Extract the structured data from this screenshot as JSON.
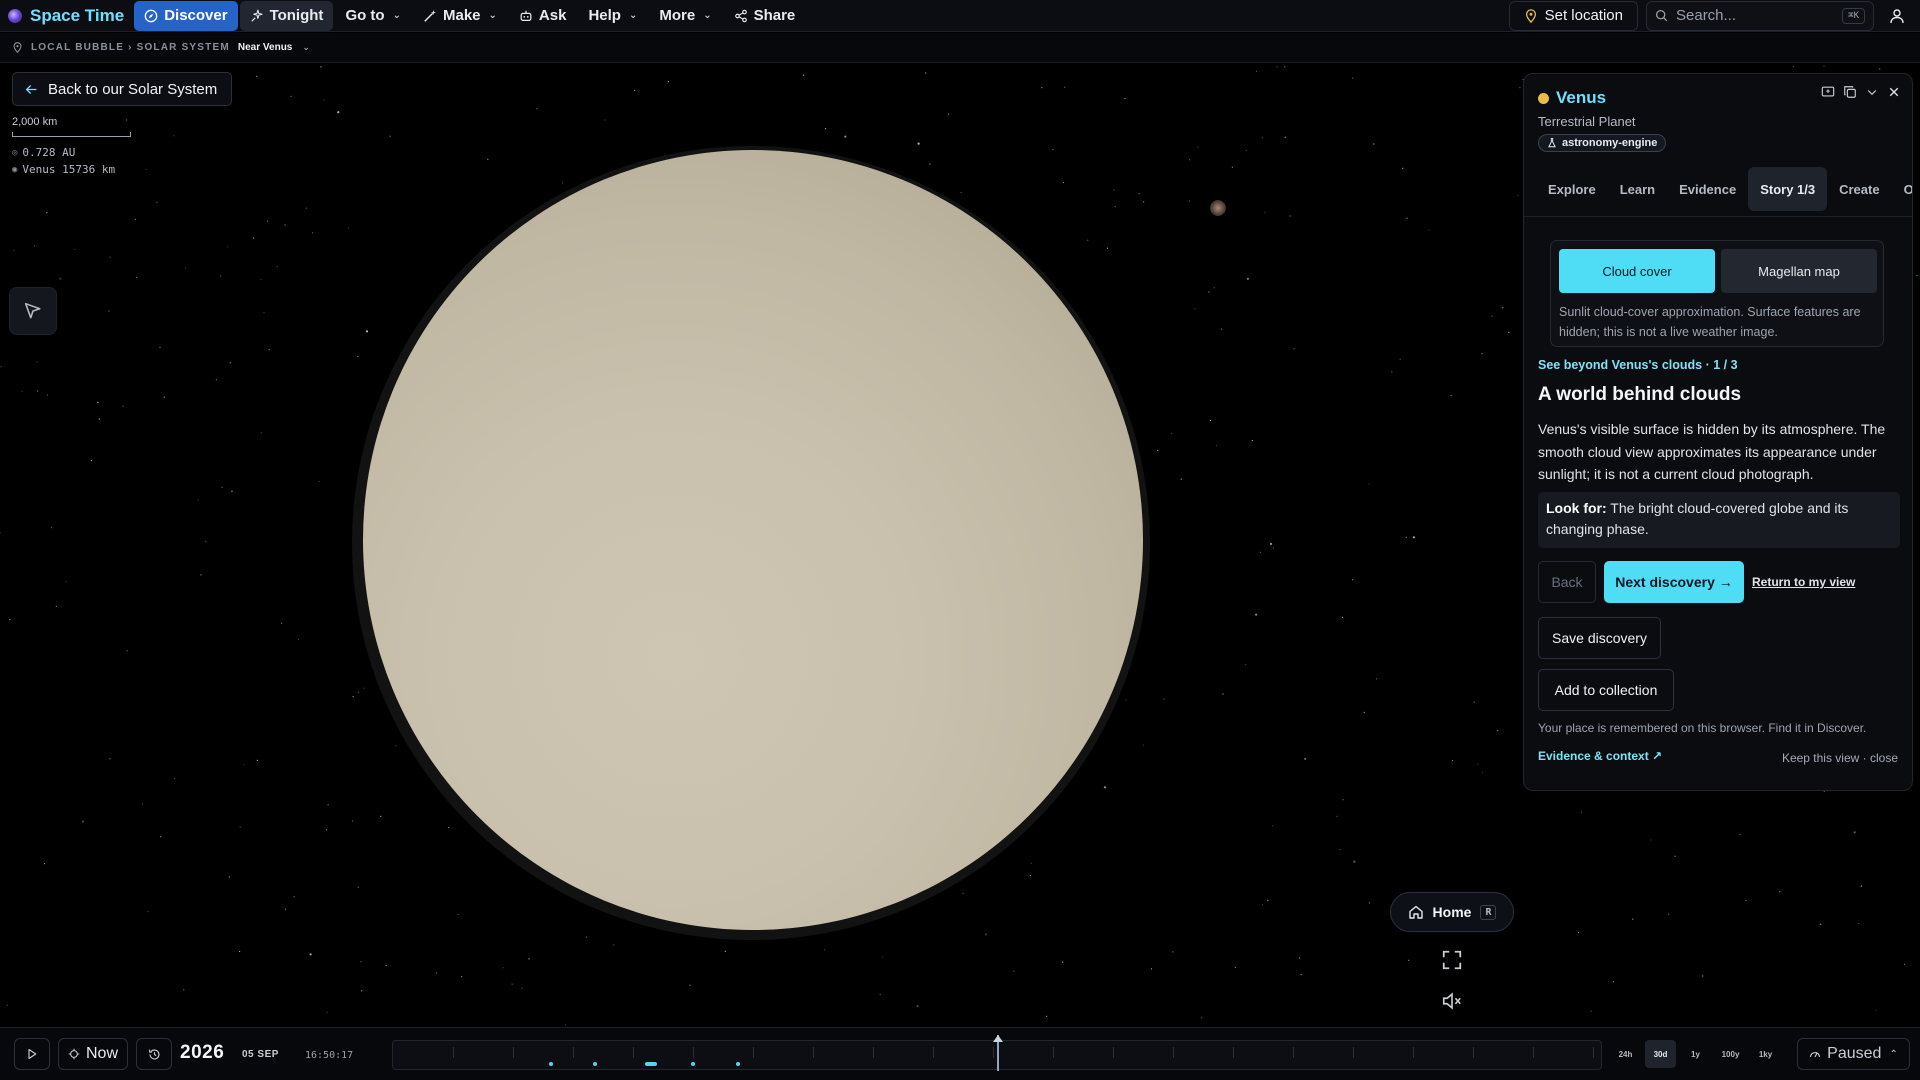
{
  "app": {
    "title": "Space Time"
  },
  "nav": {
    "discover": "Discover",
    "tonight": "Tonight",
    "goto": "Go to",
    "make": "Make",
    "ask": "Ask",
    "help": "Help",
    "more": "More",
    "share": "Share"
  },
  "topright": {
    "set_location": "Set location",
    "search_placeholder": "Search...",
    "search_shortcut": "⌘K"
  },
  "breadcrumb": {
    "path": "LOCAL BUBBLE › SOLAR SYSTEM",
    "current": "Near Venus"
  },
  "overlay": {
    "back_label": "Back to our Solar System",
    "scale_label": "2,000 km",
    "distance_au": "0.728 AU",
    "target_distance": "Venus 15736 km"
  },
  "panel": {
    "title": "Venus",
    "subtitle": "Terrestrial Planet",
    "badge": "astronomy-engine",
    "tabs": [
      {
        "label": "Explore"
      },
      {
        "label": "Learn"
      },
      {
        "label": "Evidence"
      },
      {
        "label": "Story 1/3",
        "active": true
      },
      {
        "label": "Create"
      },
      {
        "label": "Orbit"
      }
    ],
    "layers": {
      "cloud": "Cloud cover",
      "magellan": "Magellan map",
      "note": "Sunlit cloud-cover approximation. Surface features are hidden; this is not a live weather image."
    },
    "story": {
      "meta": "See beyond Venus's clouds · 1 / 3",
      "title": "A world behind clouds",
      "body": "Venus's visible surface is hidden by its atmosphere. The smooth cloud view approximates its appearance under sunlight; it is not a current cloud photograph.",
      "lookfor_label": "Look for:",
      "lookfor_text": " The bright cloud-covered globe and its changing phase."
    },
    "actions": {
      "back": "Back",
      "next": "Next discovery →",
      "return": "Return to my view",
      "save": "Save discovery",
      "collection": "Add to collection"
    },
    "remember_note": "Your place is remembered on this browser. Find it in Discover.",
    "evidence_link": "Evidence & context ↗",
    "keep_close": "Keep this view · close"
  },
  "controls": {
    "home": "Home",
    "home_key": "R"
  },
  "timeline": {
    "now": "Now",
    "year": "2026",
    "date": "05 SEP",
    "time": "16:50:17",
    "zooms": [
      {
        "label": "24h"
      },
      {
        "label": "30d",
        "active": true
      },
      {
        "label": "1y"
      },
      {
        "label": "100y"
      },
      {
        "label": "1ky"
      }
    ],
    "status": "Paused"
  },
  "colors": {
    "accent": "#6fe0ff",
    "primary_button": "#4fdcf5",
    "discover_button": "#2563c9",
    "planet": "#c9c1ad"
  }
}
